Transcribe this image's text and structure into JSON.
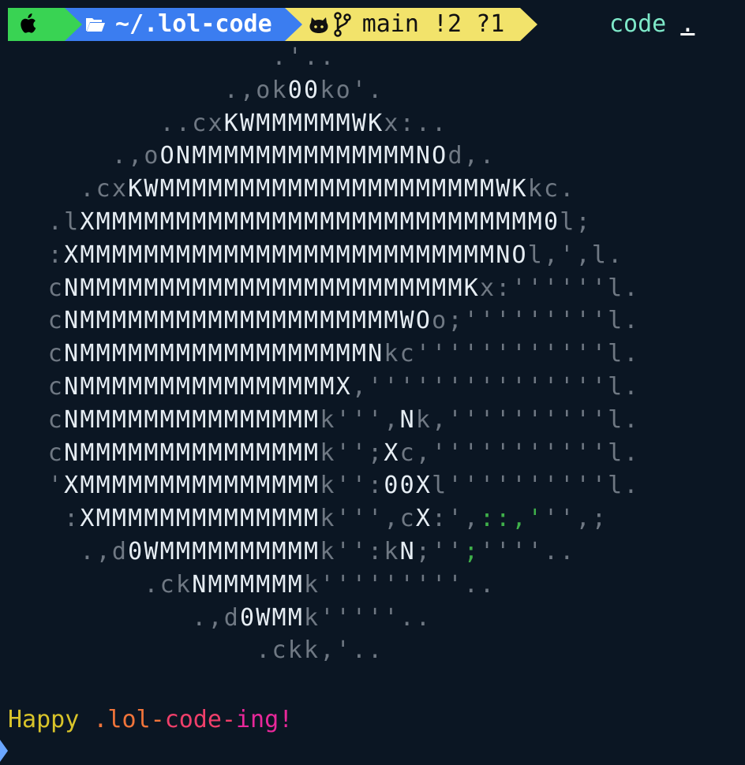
{
  "prompt": {
    "os_icon": "apple-icon",
    "directory_icon": "folder-open-icon",
    "directory": "~/.lol-code",
    "git_icons": [
      "github-icon",
      "git-branch-icon"
    ],
    "git_status": "main !2 ?1",
    "command": "code",
    "command_arg": ".",
    "colors": {
      "os_segment": "#39d353",
      "directory_segment": "#3b7df0",
      "git_segment": "#f2e36b",
      "command": "#7ee8c8"
    }
  },
  "ascii_art": [
    "                 .'..",
    "              .,ok00ko'.",
    "          ..cxKWMMMMMMWKx:..",
    "       .,oONMMMMMMMMMMMMMMNOd,.",
    "     .cxKWMMMMMMMMMMMMMMMMMMMMMWKkc.",
    "   .lXMMMMMMMMMMMMMMMMMMMMMMMMMMMM0l;",
    "   :XMMMMMMMMMMMMMMMMMMMMMMMMMMNOl,',l.",
    "   cNMMMMMMMMMMMMMMMMMMMMMMMMKx:''''''l.",
    "   cNMMMMMMMMMMMMMMMMMMMMWOo;'''''''''l.",
    "   cNMMMMMMMMMMMMMMMMMMNkc''''''''''''l.",
    "   cNMMMMMMMMMMMMMMMMX,'''''''''''''''l.",
    "   cNMMMMMMMMMMMMMMMk''',Nk,''''''''''l.",
    "   cNMMMMMMMMMMMMMMMk'';Xc,'''''''''''l.",
    "   'XMMMMMMMMMMMMMMMk'':00Xl''''''''''l.",
    "    :XMMMMMMMMMMMMMMk''',cX:',::,''',;",
    "     .,d0WMMMMMMMMMMk'':kN;'';''''..",
    "         .ckNMMMMMMk'''''''''..",
    "            .,d0WMMk'''''..",
    "                .ckk,'.."
  ],
  "message": {
    "parts": [
      "Happy ",
      ".lol-",
      "code-",
      "ing!"
    ],
    "colors": [
      "#d9c42a",
      "#f0743a",
      "#ef3f6a",
      "#e8289a"
    ]
  }
}
